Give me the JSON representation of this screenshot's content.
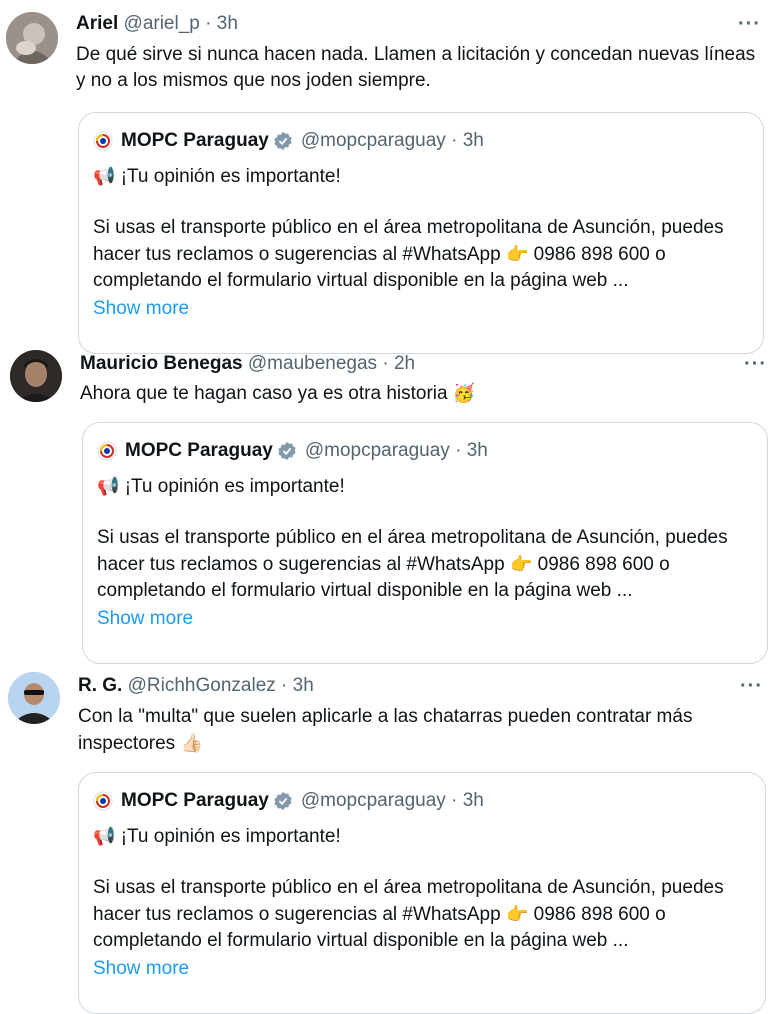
{
  "colors": {
    "accent": "#1d9bf0",
    "muted": "#536471",
    "border": "#cfd9de"
  },
  "tweets": [
    {
      "name": "Ariel",
      "handle": "@ariel_p",
      "dot": "·",
      "time": "3h",
      "more": "···",
      "text": "De qué sirve si nunca hacen nada. Llamen a licitación y concedan nuevas líneas y no a los mismos que nos joden siempre.",
      "text_emoji": "",
      "quote": {
        "name": "MOPC Paraguay",
        "handle": "@mopcparaguay",
        "dot": "·",
        "time": "3h",
        "line1_emoji": "📢",
        "line1": "¡Tu opinión es importante!",
        "body_a": "Si usas el transporte público en el área metropolitana de Asunción, puedes hacer tus reclamos o sugerencias al #WhatsApp",
        "body_emoji": "👉",
        "body_b": "0986 898 600 o completando el formulario virtual disponible en la página web ...",
        "show_more": "Show more"
      }
    },
    {
      "name": "Mauricio Benegas",
      "handle": "@maubenegas",
      "dot": "·",
      "time": "2h",
      "more": "···",
      "text": "Ahora que te hagan caso ya es otra historia",
      "text_emoji": "🥳",
      "quote": {
        "name": "MOPC Paraguay",
        "handle": "@mopcparaguay",
        "dot": "·",
        "time": "3h",
        "line1_emoji": "📢",
        "line1": "¡Tu opinión es importante!",
        "body_a": "Si usas el transporte público en el área metropolitana de Asunción, puedes hacer tus reclamos o sugerencias al #WhatsApp",
        "body_emoji": "👉",
        "body_b": "0986 898 600 o completando el formulario virtual disponible en la página web ...",
        "show_more": "Show more"
      }
    },
    {
      "name": "R. G.",
      "handle": "@RichhGonzalez",
      "dot": "·",
      "time": "3h",
      "more": "···",
      "text": "Con la \"multa\" que suelen aplicarle a las chatarras pueden contratar más inspectores",
      "text_emoji": "👍🏻",
      "quote": {
        "name": "MOPC Paraguay",
        "handle": "@mopcparaguay",
        "dot": "·",
        "time": "3h",
        "line1_emoji": "📢",
        "line1": "¡Tu opinión es importante!",
        "body_a": "Si usas el transporte público en el área metropolitana de Asunción, puedes hacer tus reclamos o sugerencias al #WhatsApp",
        "body_emoji": "👉",
        "body_b": "0986 898 600 o completando el formulario virtual disponible en la página web ...",
        "show_more": "Show more"
      }
    }
  ]
}
